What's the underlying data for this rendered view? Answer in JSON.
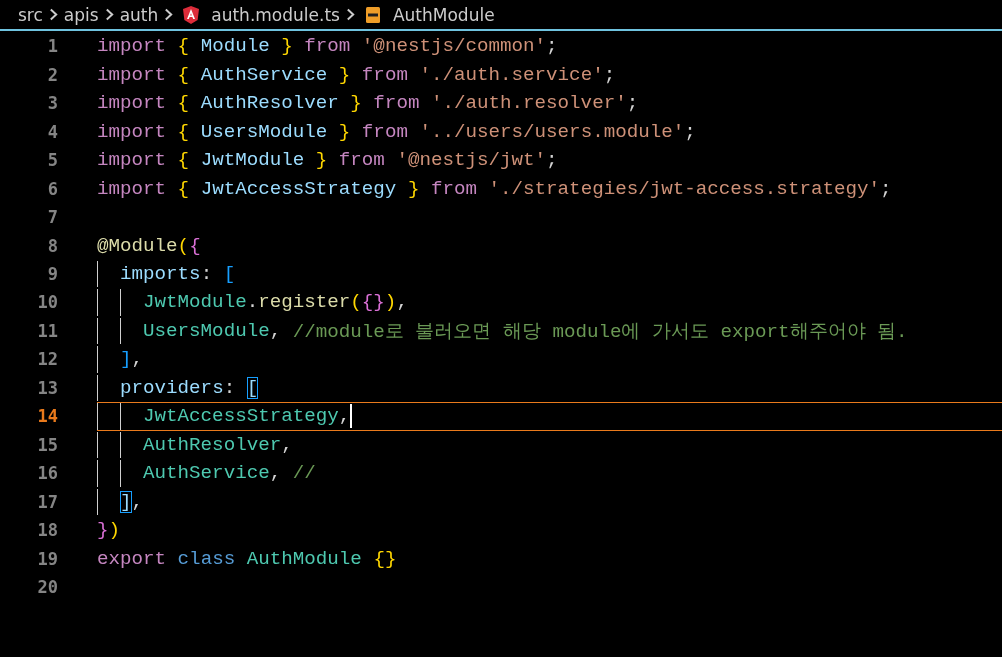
{
  "breadcrumb": [
    {
      "kind": "folder",
      "label": "src"
    },
    {
      "kind": "folder",
      "label": "apis"
    },
    {
      "kind": "folder",
      "label": "auth"
    },
    {
      "kind": "file",
      "label": "auth.module.ts"
    },
    {
      "kind": "symbol",
      "label": "AuthModule"
    }
  ],
  "lines": [
    {
      "number": "1",
      "current": false,
      "tokens": [
        {
          "kind": "keyword",
          "text": "import "
        },
        {
          "kind": "brace",
          "text": "{ "
        },
        {
          "kind": "name",
          "text": "Module "
        },
        {
          "kind": "brace",
          "text": "} "
        },
        {
          "kind": "keyword",
          "text": "from "
        },
        {
          "kind": "string",
          "text": "'@nestjs/common'"
        },
        {
          "kind": "plain",
          "text": ";"
        }
      ]
    },
    {
      "number": "2",
      "current": false,
      "tokens": [
        {
          "kind": "keyword",
          "text": "import "
        },
        {
          "kind": "brace",
          "text": "{ "
        },
        {
          "kind": "name",
          "text": "AuthService "
        },
        {
          "kind": "brace",
          "text": "} "
        },
        {
          "kind": "keyword",
          "text": "from "
        },
        {
          "kind": "string",
          "text": "'./auth.service'"
        },
        {
          "kind": "plain",
          "text": ";"
        }
      ]
    },
    {
      "number": "3",
      "current": false,
      "tokens": [
        {
          "kind": "keyword",
          "text": "import "
        },
        {
          "kind": "brace",
          "text": "{ "
        },
        {
          "kind": "name",
          "text": "AuthResolver "
        },
        {
          "kind": "brace",
          "text": "} "
        },
        {
          "kind": "keyword",
          "text": "from "
        },
        {
          "kind": "string",
          "text": "'./auth.resolver'"
        },
        {
          "kind": "plain",
          "text": ";"
        }
      ]
    },
    {
      "number": "4",
      "current": false,
      "tokens": [
        {
          "kind": "keyword",
          "text": "import "
        },
        {
          "kind": "brace",
          "text": "{ "
        },
        {
          "kind": "name",
          "text": "UsersModule "
        },
        {
          "kind": "brace",
          "text": "} "
        },
        {
          "kind": "keyword",
          "text": "from "
        },
        {
          "kind": "string",
          "text": "'../users/users.module'"
        },
        {
          "kind": "plain",
          "text": ";"
        }
      ]
    },
    {
      "number": "5",
      "current": false,
      "tokens": [
        {
          "kind": "keyword",
          "text": "import "
        },
        {
          "kind": "brace",
          "text": "{ "
        },
        {
          "kind": "name",
          "text": "JwtModule "
        },
        {
          "kind": "brace",
          "text": "} "
        },
        {
          "kind": "keyword",
          "text": "from "
        },
        {
          "kind": "string",
          "text": "'@nestjs/jwt'"
        },
        {
          "kind": "plain",
          "text": ";"
        }
      ]
    },
    {
      "number": "6",
      "current": false,
      "tokens": [
        {
          "kind": "keyword",
          "text": "import "
        },
        {
          "kind": "brace",
          "text": "{ "
        },
        {
          "kind": "name",
          "text": "JwtAccessStrategy "
        },
        {
          "kind": "brace",
          "text": "} "
        },
        {
          "kind": "keyword",
          "text": "from "
        },
        {
          "kind": "string",
          "text": "'./strategies/jwt-access.strategy'"
        },
        {
          "kind": "plain",
          "text": ";"
        }
      ]
    },
    {
      "number": "7",
      "current": false
    },
    {
      "number": "8",
      "current": false,
      "tokens": [
        {
          "kind": "func",
          "text": "@Module"
        },
        {
          "kind": "brace",
          "text": "("
        },
        {
          "kind": "brace2",
          "text": "{"
        }
      ]
    },
    {
      "number": "9",
      "current": false,
      "guides": [
        {
          "active": true
        }
      ],
      "tokens": [
        {
          "kind": "name",
          "text": "imports"
        },
        {
          "kind": "plain",
          "text": ": "
        },
        {
          "kind": "brace3",
          "text": "["
        }
      ]
    },
    {
      "number": "10",
      "current": false,
      "guides": [
        {
          "active": true
        },
        {
          "active": true
        }
      ],
      "tokens": [
        {
          "kind": "type",
          "text": "JwtModule"
        },
        {
          "kind": "plain",
          "text": "."
        },
        {
          "kind": "func",
          "text": "register"
        },
        {
          "kind": "brace",
          "text": "("
        },
        {
          "kind": "brace2",
          "text": "{}"
        },
        {
          "kind": "brace",
          "text": ")"
        },
        {
          "kind": "plain",
          "text": ","
        }
      ]
    },
    {
      "number": "11",
      "current": false,
      "guides": [
        {
          "active": true
        },
        {
          "active": true
        }
      ],
      "tokens": [
        {
          "kind": "type",
          "text": "UsersModule"
        },
        {
          "kind": "plain",
          "text": ", "
        },
        {
          "kind": "comment",
          "text": "//module로 불러오면 해당 module에 가서도 export해주어야 됨."
        }
      ]
    },
    {
      "number": "12",
      "current": false,
      "guides": [
        {
          "active": true
        }
      ],
      "tokens": [
        {
          "kind": "brace3",
          "text": "]"
        },
        {
          "kind": "plain",
          "text": ","
        }
      ]
    },
    {
      "number": "13",
      "current": false,
      "guides": [
        {
          "active": true
        }
      ],
      "tokens": [
        {
          "kind": "name",
          "text": "providers"
        },
        {
          "kind": "plain",
          "text": ": "
        },
        {
          "kind": "match",
          "text": "["
        }
      ]
    },
    {
      "number": "14",
      "current": true,
      "guides": [
        {
          "active": true
        },
        {
          "active": true
        }
      ],
      "tokens": [
        {
          "kind": "type",
          "text": "JwtAccessStrategy"
        },
        {
          "kind": "plain",
          "text": ","
        }
      ]
    },
    {
      "number": "15",
      "current": false,
      "guides": [
        {
          "active": true
        },
        {
          "active": true
        }
      ],
      "tokens": [
        {
          "kind": "type",
          "text": "AuthResolver"
        },
        {
          "kind": "plain",
          "text": ","
        }
      ]
    },
    {
      "number": "16",
      "current": false,
      "guides": [
        {
          "active": true
        },
        {
          "active": true
        }
      ],
      "tokens": [
        {
          "kind": "type",
          "text": "AuthService"
        },
        {
          "kind": "plain",
          "text": ", "
        },
        {
          "kind": "comment",
          "text": "//"
        }
      ]
    },
    {
      "number": "17",
      "current": false,
      "guides": [
        {
          "active": true
        }
      ],
      "tokens": [
        {
          "kind": "match",
          "text": "]"
        },
        {
          "kind": "plain",
          "text": ","
        }
      ]
    },
    {
      "number": "18",
      "current": false,
      "tokens": [
        {
          "kind": "brace2",
          "text": "}"
        },
        {
          "kind": "brace",
          "text": ")"
        }
      ]
    },
    {
      "number": "19",
      "current": false,
      "tokens": [
        {
          "kind": "keyword",
          "text": "export "
        },
        {
          "kind": "storage",
          "text": "class "
        },
        {
          "kind": "type",
          "text": "AuthModule "
        },
        {
          "kind": "brace",
          "text": "{}"
        }
      ]
    },
    {
      "number": "20",
      "current": false
    }
  ]
}
